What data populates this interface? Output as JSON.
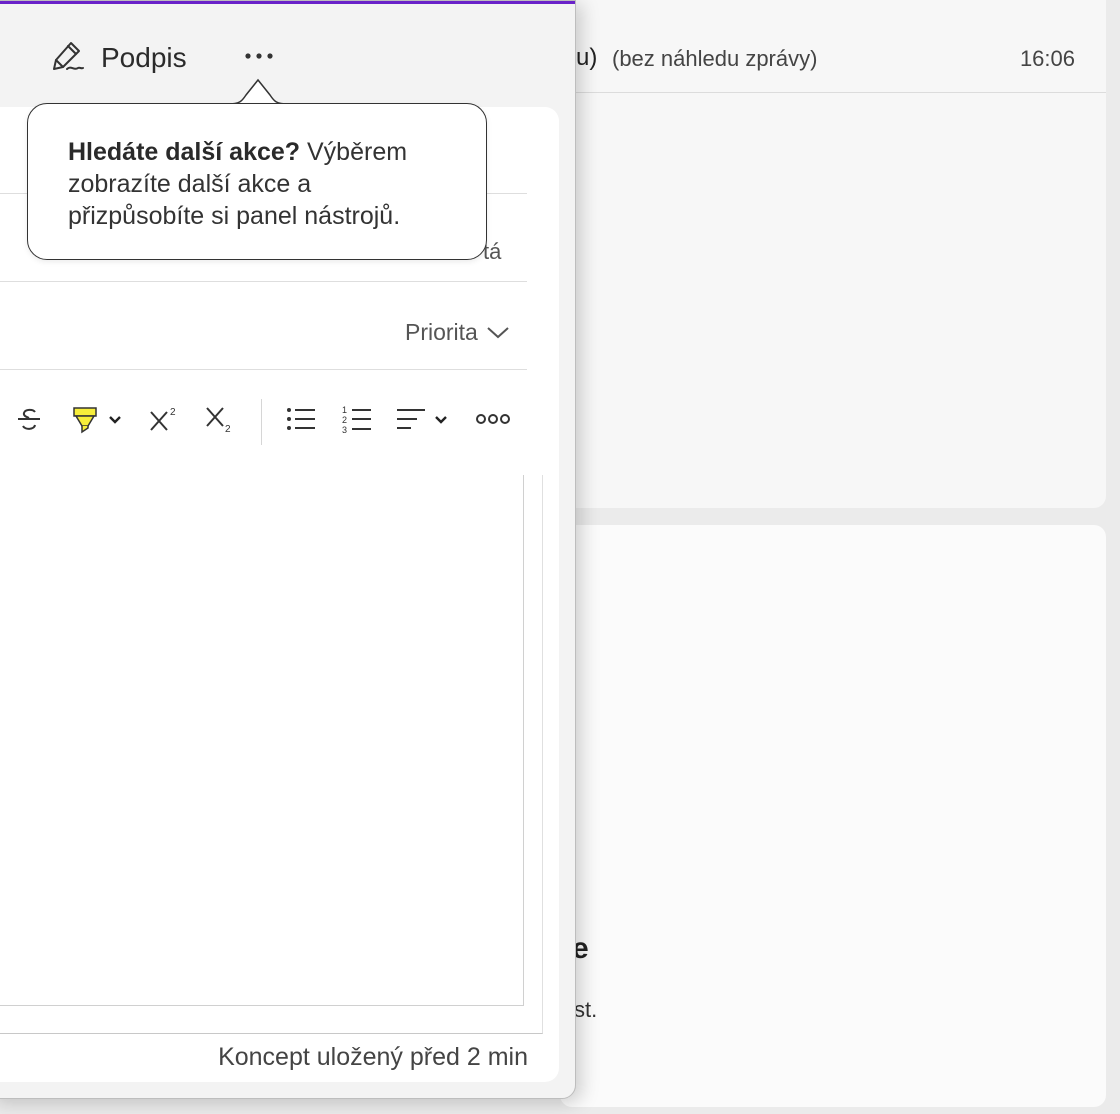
{
  "background": {
    "message_row": {
      "sender_fragment": "u)",
      "preview": "(bez náhledu zprávy)",
      "time": "16:06"
    },
    "reading_fragment_heading": "e",
    "reading_fragment_text": "st."
  },
  "compose": {
    "toolbar": {
      "signature_label": "Podpis",
      "signature_icon": "signature-pen-icon",
      "more_icon": "more-horizontal-icon"
    },
    "field_fragment": "tá",
    "priority_label": "Priorita",
    "format_toolbar": {
      "items": [
        "strikethrough-icon",
        "highlight-icon",
        "highlight-dropdown-icon",
        "superscript-icon",
        "subscript-icon",
        "bullet-list-icon",
        "numbered-list-icon",
        "align-icon",
        "align-dropdown-icon",
        "more-options-icon"
      ],
      "highlight_color": "#f7ee3a"
    },
    "status": "Koncept uložený před 2 min",
    "accent_color": "#6a22c9"
  },
  "tooltip": {
    "bold": "Hledáte další akce?",
    "text_line1": " Výběrem",
    "text_line2": "zobrazíte další akce a",
    "text_line3": "přizpůsobíte si panel nástrojů."
  }
}
